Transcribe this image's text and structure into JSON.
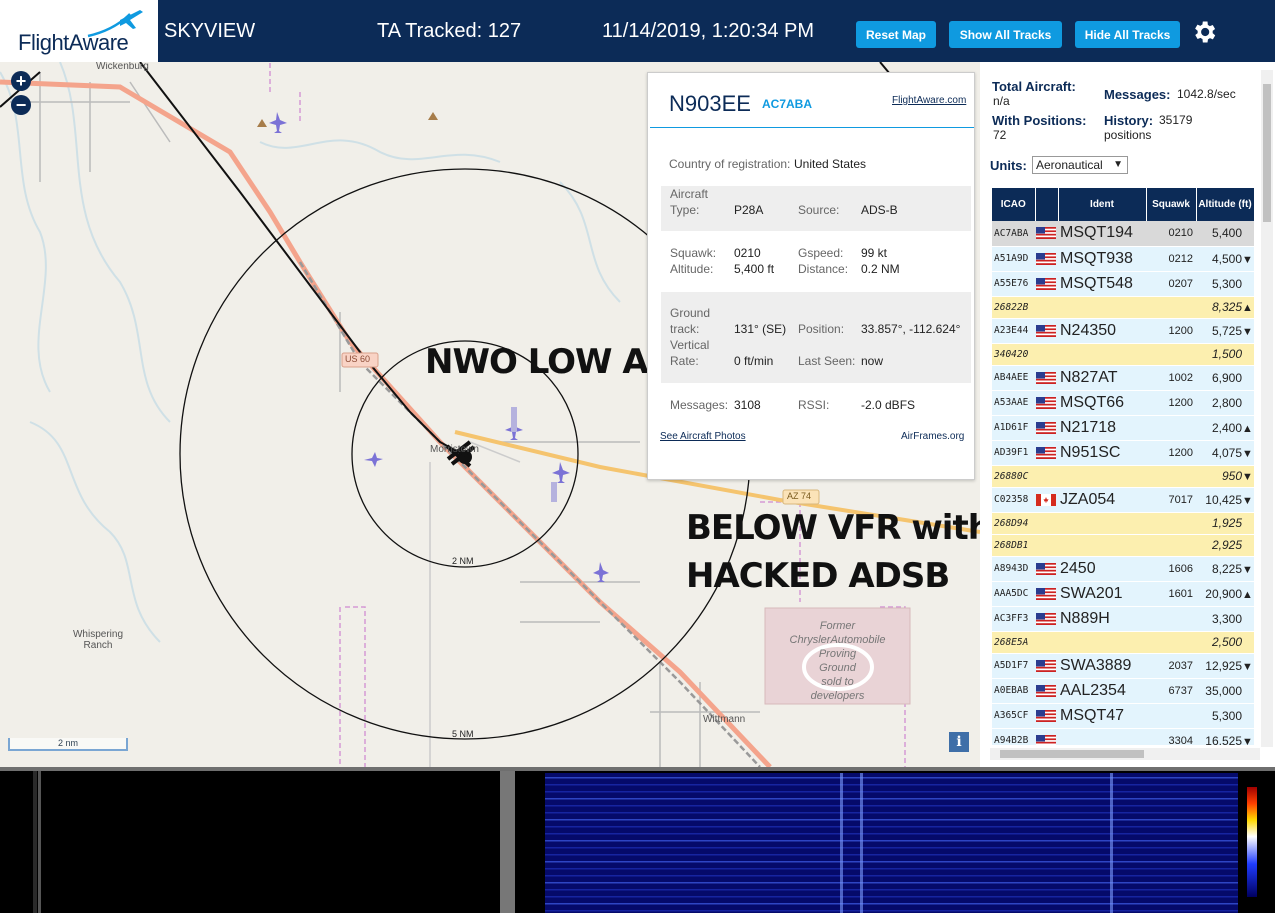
{
  "header": {
    "brand": "FlightAware",
    "app_name": "SKYVIEW",
    "tracked": "TA Tracked: 127",
    "datetime": "11/14/2019, 1:20:34 PM",
    "buttons": {
      "reset": "Reset Map",
      "show_all": "Show All Tracks",
      "hide_all": "Hide All Tracks"
    },
    "colors": {
      "navy": "#0c2b57",
      "button": "#0f9ae0"
    }
  },
  "map": {
    "overlays": {
      "low_alt": "NWO LOW ALT",
      "below_vfr_1": "BELOW VFR with",
      "below_vfr_2": "HACKED ADSB"
    },
    "labels": {
      "wickenburg": "Wickenburg",
      "us60": "US 60",
      "az74": "AZ 74",
      "morristown": "Morristown",
      "whispering1": "Whispering",
      "whispering2": "Ranch",
      "wittmann": "Wittmann",
      "former1": "Former",
      "former2": "ChryslerAutomobile",
      "former3": "Proving",
      "former4": "Ground",
      "former5": "sold to",
      "former6": "developers",
      "ring2": "2 NM",
      "ring5": "5 NM"
    },
    "scale": "2 nm",
    "zoom_in": "+",
    "zoom_out": "−",
    "info": "i"
  },
  "popup": {
    "registration": "N903EE",
    "icao": "AC7ABA",
    "fa_link": "FlightAware.com",
    "country_label": "Country of registration:",
    "country_value": "United States",
    "aircraft_label_1": "Aircraft",
    "aircraft_label_2": "Type:",
    "aircraft_value": "P28A",
    "source_label": "Source:",
    "source_value": "ADS-B",
    "squawk_label": "Squawk:",
    "squawk_value": "0210",
    "gspeed_label": "Gspeed:",
    "gspeed_value": "99 kt",
    "altitude_label": "Altitude:",
    "altitude_value": "5,400 ft",
    "distance_label": "Distance:",
    "distance_value": "0.2 NM",
    "ground_label_1": "Ground",
    "ground_label_2": "track:",
    "ground_value": "131° (SE)",
    "position_label": "Position:",
    "position_value": "33.857°, -112.624°",
    "vertical_label_1": "Vertical",
    "vertical_label_2": "Rate:",
    "vertical_value": "0 ft/min",
    "lastseen_label": "Last Seen:",
    "lastseen_value": "now",
    "messages_label": "Messages:",
    "messages_value": "3108",
    "rssi_label": "RSSI:",
    "rssi_value": "-2.0 dBFS",
    "photos_link": "See Aircraft Photos",
    "airframes_link": "AirFrames.org"
  },
  "panel": {
    "total_label": "Total Aircraft:",
    "total_value": "n/a",
    "messages_label": "Messages:",
    "messages_value": "1042.8/sec",
    "positions_label": "With Positions:",
    "positions_value": "72",
    "history_label": "History:",
    "history_value_1": "35179",
    "history_value_2": "positions",
    "units_label": "Units:",
    "units_value": "Aeronautical",
    "columns": [
      "ICAO",
      "Ident",
      "Squawk",
      "Altitude (ft)"
    ],
    "rows": [
      {
        "icao": "AC7ABA",
        "flag": "us",
        "ident": "MSQT194",
        "squawk": "0210",
        "alt": "5,400",
        "trend": "",
        "style": "sel"
      },
      {
        "icao": "A51A9D",
        "flag": "us",
        "ident": "MSQT938",
        "squawk": "0212",
        "alt": "4,500",
        "trend": "▼",
        "style": "blue"
      },
      {
        "icao": "A55E76",
        "flag": "us",
        "ident": "MSQT548",
        "squawk": "0207",
        "alt": "5,300",
        "trend": "",
        "style": "blue"
      },
      {
        "icao": "26822B",
        "flag": "",
        "ident": "",
        "squawk": "",
        "alt": "8,325",
        "trend": "▲",
        "style": "yel"
      },
      {
        "icao": "A23E44",
        "flag": "us",
        "ident": "N24350",
        "squawk": "1200",
        "alt": "5,725",
        "trend": "▼",
        "style": "blue"
      },
      {
        "icao": "340420",
        "flag": "",
        "ident": "",
        "squawk": "",
        "alt": "1,500",
        "trend": "",
        "style": "yel"
      },
      {
        "icao": "AB4AEE",
        "flag": "us",
        "ident": "N827AT",
        "squawk": "1002",
        "alt": "6,900",
        "trend": "",
        "style": "blue"
      },
      {
        "icao": "A53AAE",
        "flag": "us",
        "ident": "MSQT66",
        "squawk": "1200",
        "alt": "2,800",
        "trend": "",
        "style": "blue"
      },
      {
        "icao": "A1D61F",
        "flag": "us",
        "ident": "N21718",
        "squawk": "",
        "alt": "2,400",
        "trend": "▲",
        "style": "blue"
      },
      {
        "icao": "AD39F1",
        "flag": "us",
        "ident": "N951SC",
        "squawk": "1200",
        "alt": "4,075",
        "trend": "▼",
        "style": "blue"
      },
      {
        "icao": "26880C",
        "flag": "",
        "ident": "",
        "squawk": "",
        "alt": "950",
        "trend": "▼",
        "style": "yel"
      },
      {
        "icao": "C02358",
        "flag": "ca",
        "ident": "JZA054",
        "squawk": "7017",
        "alt": "10,425",
        "trend": "▼",
        "style": "blue"
      },
      {
        "icao": "268D94",
        "flag": "",
        "ident": "",
        "squawk": "",
        "alt": "1,925",
        "trend": "",
        "style": "yel"
      },
      {
        "icao": "268DB1",
        "flag": "",
        "ident": "",
        "squawk": "",
        "alt": "2,925",
        "trend": "",
        "style": "yel"
      },
      {
        "icao": "A8943D",
        "flag": "us",
        "ident": "2450",
        "squawk": "1606",
        "alt": "8,225",
        "trend": "▼",
        "style": "blue"
      },
      {
        "icao": "AAA5DC",
        "flag": "us",
        "ident": "SWA201",
        "squawk": "1601",
        "alt": "20,900",
        "trend": "▲",
        "style": "blue"
      },
      {
        "icao": "AC3FF3",
        "flag": "us",
        "ident": "N889H",
        "squawk": "",
        "alt": "3,300",
        "trend": "",
        "style": "blue"
      },
      {
        "icao": "268E5A",
        "flag": "",
        "ident": "",
        "squawk": "",
        "alt": "2,500",
        "trend": "",
        "style": "yel"
      },
      {
        "icao": "A5D1F7",
        "flag": "us",
        "ident": "SWA3889",
        "squawk": "2037",
        "alt": "12,925",
        "trend": "▼",
        "style": "blue"
      },
      {
        "icao": "A0EBAB",
        "flag": "us",
        "ident": "AAL2354",
        "squawk": "6737",
        "alt": "35,000",
        "trend": "",
        "style": "blue"
      },
      {
        "icao": "A365CF",
        "flag": "us",
        "ident": "MSQT47",
        "squawk": "",
        "alt": "5,300",
        "trend": "",
        "style": "blue"
      },
      {
        "icao": "A94B2B",
        "flag": "us",
        "ident": "",
        "squawk": "3304",
        "alt": "16,525",
        "trend": "▼",
        "style": "blue"
      }
    ]
  }
}
